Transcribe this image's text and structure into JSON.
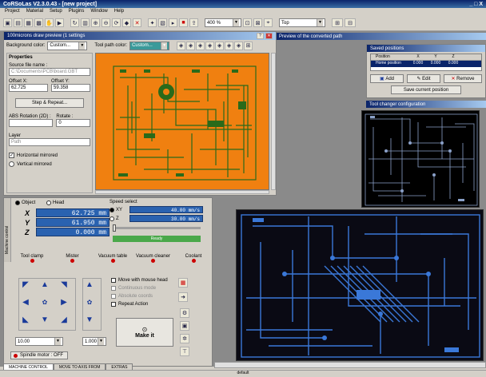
{
  "app": {
    "title": "CoRSoLas V2.3.0.43 - [new project]",
    "win_buttons": "_ □ X"
  },
  "menu": [
    "Project",
    "Material",
    "Setup",
    "Plugins",
    "Window",
    "Help"
  ],
  "toolbar": {
    "zoom_value": "400 %",
    "mode_value": "Top",
    "btn_a": "⊞",
    "btn_b": "⊟"
  },
  "preview": {
    "title": "100microns draw preview (1 settings",
    "bg_color_label": "Background color:",
    "bg_color_value": "Custom...",
    "toolpath_color_label": "Tool path color:",
    "toolpath_color_value": "Custom...",
    "properties_label": "Properties",
    "source_label": "Source file name :",
    "source_value": "C:\\Documents\\PCB\\board.GBT",
    "offset_x_label": "Offset X:",
    "offset_x_value": "62.725",
    "offset_y_label": "Offset Y:",
    "offset_y_value": "59.358",
    "step_repeat": "Step & Repeat...",
    "abs_rotation_label": "ABS Rotation (2D) :",
    "rotate_label": "Rotate :",
    "rotate_value": "0",
    "layer_label": "Layer",
    "layer_value": "Path",
    "horizontal_mirrored": "Horizontal mirrored",
    "vertical_mirrored": "Vertical mirrored",
    "bg_color": "#f08010",
    "trace_color": "#2a6a1a"
  },
  "header_strip": "Preview of the converted path",
  "positions": {
    "title": "Saved positions",
    "columns": [
      "Position",
      "X",
      "Y",
      "Z"
    ],
    "row": [
      "Home position",
      "0.000",
      "0.000",
      "0.000"
    ],
    "add": "Add",
    "edit": "Edit",
    "remove": "Remove",
    "save_current": "Save current position"
  },
  "tool_changer": {
    "title": "Tool changer configuration"
  },
  "machine": {
    "object_label": "Object",
    "head_label": "Head",
    "speed_label": "Speed select",
    "axes": [
      "X",
      "Y",
      "Z"
    ],
    "x_value": "62.725 mm",
    "y_value": "61.950 mm",
    "z_value": "0.000 mm",
    "speed_xy_label": "XY",
    "speed_xy_value": "40.00 mm/s",
    "speed_z_label": "Z",
    "speed_z_value": "30.00 mm/s",
    "ready": "Ready",
    "side_tab": "Machine control",
    "indicators": [
      "Tool clamp",
      "Mister",
      "Vacuum table",
      "Vacuum cleaner",
      "Coolant"
    ],
    "move_with_mouse": "Move with mouse head",
    "continuous_mode": "Continuous mode",
    "abs_coords": "Absolute coords",
    "repeat_action": "Repeat Action",
    "step_value": "10.00",
    "z_step_value": "1.000",
    "make_it": "Make it",
    "spindle": "Spindle motor : OFF",
    "tabs": [
      "MACHINE CONTROL",
      "MOVE TO AXIS FROM",
      "EXTRAS"
    ]
  },
  "status_bar": {
    "center": "default"
  }
}
